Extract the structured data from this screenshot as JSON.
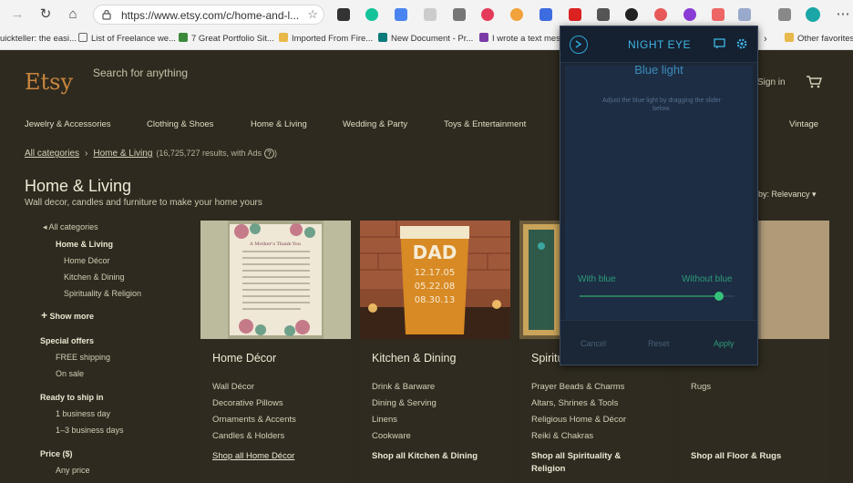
{
  "browser": {
    "url": "https://www.etsy.com/c/home-and-l...",
    "bookmarks": [
      "uickteller: the easi...",
      "List of Freelance we...",
      "7 Great Portfolio Sit...",
      "Imported From Fire...",
      "New Document - Pr...",
      "I wrote a text mess",
      "Other favorites"
    ]
  },
  "header": {
    "logo": "Etsy",
    "search_placeholder": "Search for anything",
    "sign_in": "Sign in"
  },
  "categories": [
    "Jewelry & Accessories",
    "Clothing & Shoes",
    "Home & Living",
    "Wedding & Party",
    "Toys & Entertainment",
    "Vintage"
  ],
  "breadcrumb": {
    "root": "All categories",
    "current": "Home & Living",
    "results": "(16,725,727 results, with Ads",
    "help": "?",
    "close": ")"
  },
  "page": {
    "title": "Home & Living",
    "subtitle": "Wall decor, candles and furniture to make your home yours",
    "sort": "by: Relevancy"
  },
  "sidebar": {
    "all_categories": "All categories",
    "current": "Home & Living",
    "subcategories": [
      "Home Décor",
      "Kitchen & Dining",
      "Spirituality & Religion"
    ],
    "show_more": "Show more",
    "special_offers": {
      "heading": "Special offers",
      "items": [
        "FREE shipping",
        "On sale"
      ]
    },
    "ready_to_ship": {
      "heading": "Ready to ship in",
      "items": [
        "1 business day",
        "1–3 business days"
      ]
    },
    "price": {
      "heading": "Price ($)",
      "items": [
        "Any price"
      ]
    }
  },
  "cards": [
    {
      "title": "Home Décor",
      "links": [
        "Wall Décor",
        "Decorative Pillows",
        "Ornaments & Accents",
        "Candles & Holders"
      ],
      "shop_all": "Shop all Home Décor",
      "image_text": "A Mother's Thank You"
    },
    {
      "title": "Kitchen & Dining",
      "links": [
        "Drink & Barware",
        "Dining & Serving",
        "Linens",
        "Cookware"
      ],
      "shop_all": "Shop all Kitchen & Dining",
      "image_text": [
        "DAD",
        "12.17.05",
        "05.22.08",
        "08.30.13"
      ]
    },
    {
      "title": "Spiritu",
      "links": [
        "Prayer Beads & Charms",
        "Altars, Shrines & Tools",
        "Religious Home & Décor",
        "Reiki & Chakras"
      ],
      "shop_all": [
        "Shop all Spirituality &",
        "Religion"
      ]
    },
    {
      "title": "",
      "links": [
        "Rugs"
      ],
      "shop_all": "Shop all Floor & Rugs"
    }
  ],
  "night_eye": {
    "title": "NIGHT EYE",
    "section": "Blue light",
    "description": "Adjust the blue light by dragging the slider below.",
    "with_blue": "With blue",
    "without_blue": "Without blue",
    "slider_value": 0.9,
    "cancel": "Cancel",
    "reset": "Reset",
    "apply": "Apply"
  }
}
